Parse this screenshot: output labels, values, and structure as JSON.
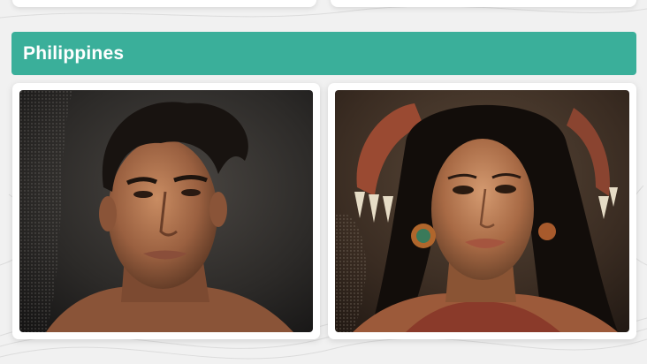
{
  "section": {
    "title": "Philippines"
  },
  "images": [
    {
      "subject": "portrait-man",
      "description_icon": "portrait-photo-icon"
    },
    {
      "subject": "portrait-woman",
      "description_icon": "portrait-photo-icon"
    }
  ],
  "colors": {
    "header_bg": "#3aaf9a",
    "header_text": "#ffffff",
    "page_bg": "#f1f1f1",
    "card_bg": "#ffffff"
  }
}
